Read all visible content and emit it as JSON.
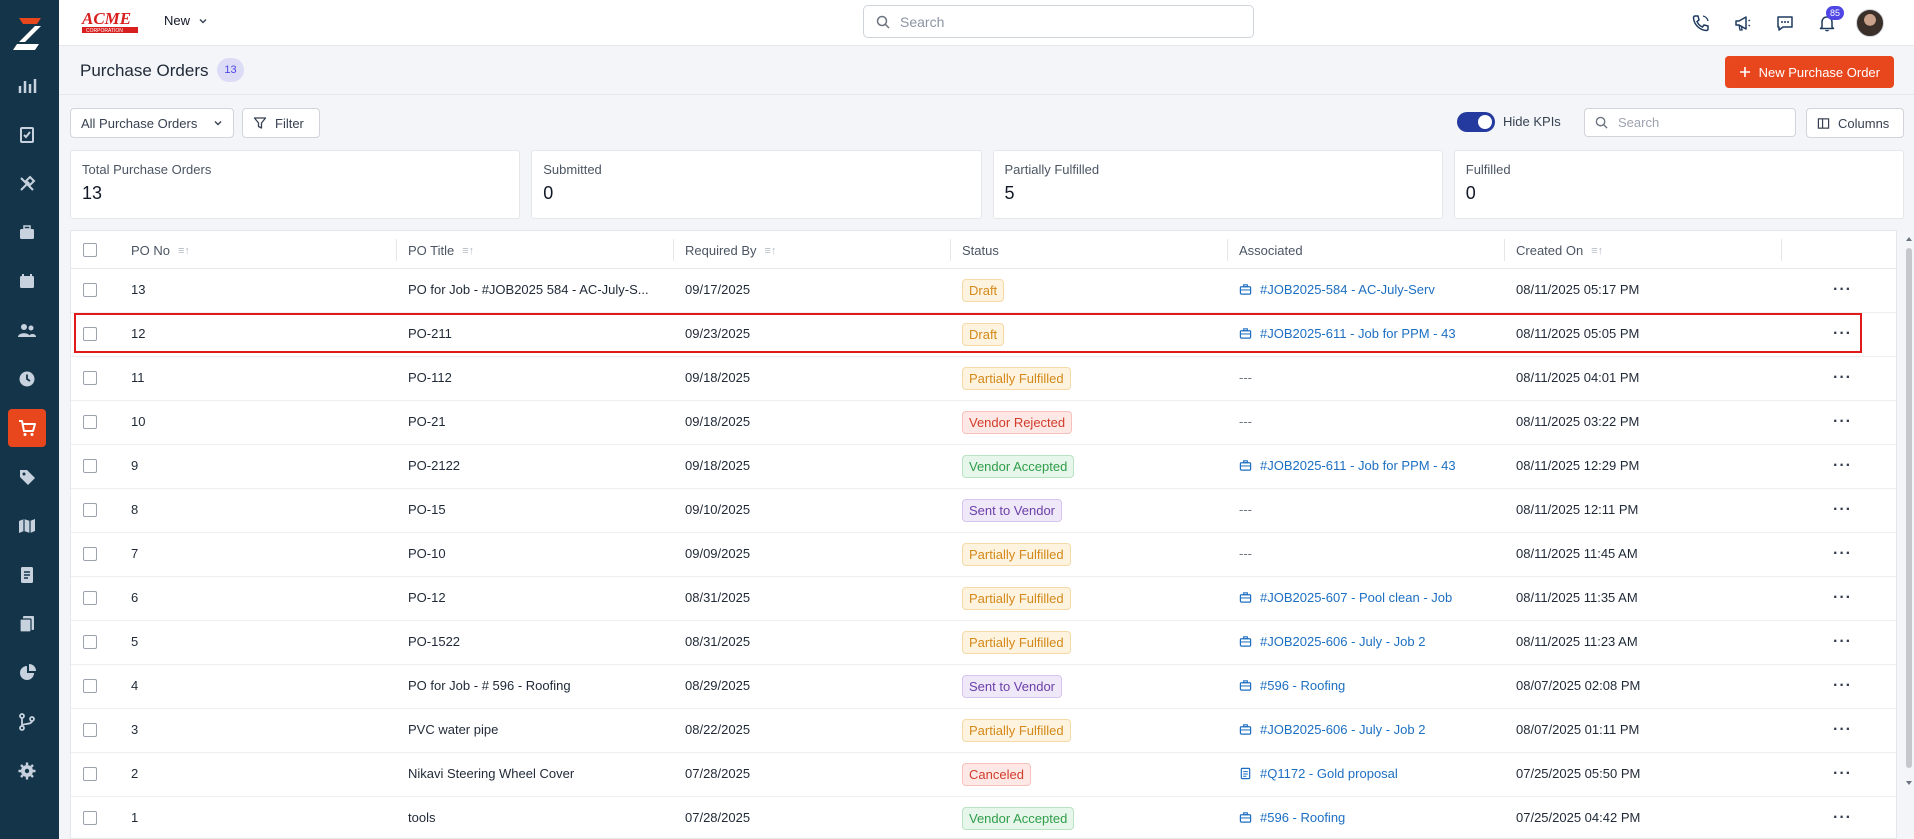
{
  "brand": {
    "logo_text": "ACME CORPORATION"
  },
  "topbar": {
    "new_label": "New",
    "search_placeholder": "Search",
    "notification_count": "85"
  },
  "page": {
    "title": "Purchase Orders",
    "count": "13",
    "new_button_label": "New Purchase Order"
  },
  "toolbar": {
    "view_label": "All Purchase Orders",
    "filter_label": "Filter",
    "hide_kpis_label": "Hide KPIs",
    "search_placeholder": "Search",
    "columns_label": "Columns"
  },
  "kpis": [
    {
      "label": "Total Purchase Orders",
      "value": "13"
    },
    {
      "label": "Submitted",
      "value": "0"
    },
    {
      "label": "Partially Fulfilled",
      "value": "5"
    },
    {
      "label": "Fulfilled",
      "value": "0"
    }
  ],
  "table": {
    "headers": [
      "PO No",
      "PO Title",
      "Required By",
      "Status",
      "Associated",
      "Created On"
    ],
    "rows": [
      {
        "no": "13",
        "title": "PO for Job - #JOB2025 584 - AC-July-S...",
        "required": "09/17/2025",
        "status": "Draft",
        "assoc": "#JOB2025-584 - AC-July-Serv",
        "assoc_icon": "briefcase",
        "created": "08/11/2025 05:17 PM"
      },
      {
        "no": "12",
        "title": "PO-211",
        "required": "09/23/2025",
        "status": "Draft",
        "assoc": "#JOB2025-611 - Job for PPM - 43",
        "assoc_icon": "briefcase",
        "created": "08/11/2025 05:05 PM"
      },
      {
        "no": "11",
        "title": "PO-112",
        "required": "09/18/2025",
        "status": "Partially Fulfilled",
        "assoc": "---",
        "assoc_icon": "",
        "created": "08/11/2025 04:01 PM"
      },
      {
        "no": "10",
        "title": "PO-21",
        "required": "09/18/2025",
        "status": "Vendor Rejected",
        "assoc": "---",
        "assoc_icon": "",
        "created": "08/11/2025 03:22 PM"
      },
      {
        "no": "9",
        "title": "PO-2122",
        "required": "09/18/2025",
        "status": "Vendor Accepted",
        "assoc": "#JOB2025-611 - Job for PPM - 43",
        "assoc_icon": "briefcase",
        "created": "08/11/2025 12:29 PM"
      },
      {
        "no": "8",
        "title": "PO-15",
        "required": "09/10/2025",
        "status": "Sent to Vendor",
        "assoc": "---",
        "assoc_icon": "",
        "created": "08/11/2025 12:11 PM"
      },
      {
        "no": "7",
        "title": "PO-10",
        "required": "09/09/2025",
        "status": "Partially Fulfilled",
        "assoc": "---",
        "assoc_icon": "",
        "created": "08/11/2025 11:45 AM"
      },
      {
        "no": "6",
        "title": "PO-12",
        "required": "08/31/2025",
        "status": "Partially Fulfilled",
        "assoc": "#JOB2025-607 - Pool clean - Job",
        "assoc_icon": "briefcase",
        "created": "08/11/2025 11:35 AM"
      },
      {
        "no": "5",
        "title": "PO-1522",
        "required": "08/31/2025",
        "status": "Partially Fulfilled",
        "assoc": "#JOB2025-606 - July - Job 2",
        "assoc_icon": "briefcase",
        "created": "08/11/2025 11:23 AM"
      },
      {
        "no": "4",
        "title": "PO for Job - # 596 - Roofing",
        "required": "08/29/2025",
        "status": "Sent to Vendor",
        "assoc": "#596 - Roofing",
        "assoc_icon": "briefcase",
        "created": "08/07/2025 02:08 PM"
      },
      {
        "no": "3",
        "title": "PVC water pipe",
        "required": "08/22/2025",
        "status": "Partially Fulfilled",
        "assoc": "#JOB2025-606 - July - Job 2",
        "assoc_icon": "briefcase",
        "created": "08/07/2025 01:11 PM"
      },
      {
        "no": "2",
        "title": "Nikavi Steering Wheel Cover",
        "required": "07/28/2025",
        "status": "Canceled",
        "assoc": "#Q1172 - Gold proposal",
        "assoc_icon": "document",
        "created": "07/25/2025 05:50 PM"
      },
      {
        "no": "1",
        "title": "tools",
        "required": "07/28/2025",
        "status": "Vendor Accepted",
        "assoc": "#596 - Roofing",
        "assoc_icon": "briefcase",
        "created": "07/25/2025 04:42 PM"
      }
    ]
  },
  "status_colors": {
    "Draft": {
      "bg": "#fdf3df",
      "fg": "#d4891a",
      "border": "#f5d9a6"
    },
    "Partially Fulfilled": {
      "bg": "#fdf3df",
      "fg": "#d4891a",
      "border": "#f5d9a6"
    },
    "Vendor Rejected": {
      "bg": "#fde8e6",
      "fg": "#d23c2b",
      "border": "#f6c2bb"
    },
    "Vendor Accepted": {
      "bg": "#e6f6ea",
      "fg": "#2f9e4a",
      "border": "#b9e3c4"
    },
    "Sent to Vendor": {
      "bg": "#efe8f8",
      "fg": "#6b3fa8",
      "border": "#d6c5ee"
    },
    "Canceled": {
      "bg": "#fde8e6",
      "fg": "#d23c2b",
      "border": "#f6c2bb"
    }
  },
  "colors": {
    "accent": "#e8461c",
    "sidebar": "#143449",
    "link": "#1d6fc2"
  },
  "sidebar_icons": [
    "dashboard-icon",
    "clipboard-icon",
    "tools-icon",
    "briefcase-icon",
    "calendar-icon",
    "users-icon",
    "clock-icon",
    "cart-icon",
    "tag-icon",
    "map-icon",
    "invoice-icon",
    "documents-icon",
    "pie-chart-icon",
    "workflow-icon",
    "settings-icon"
  ]
}
